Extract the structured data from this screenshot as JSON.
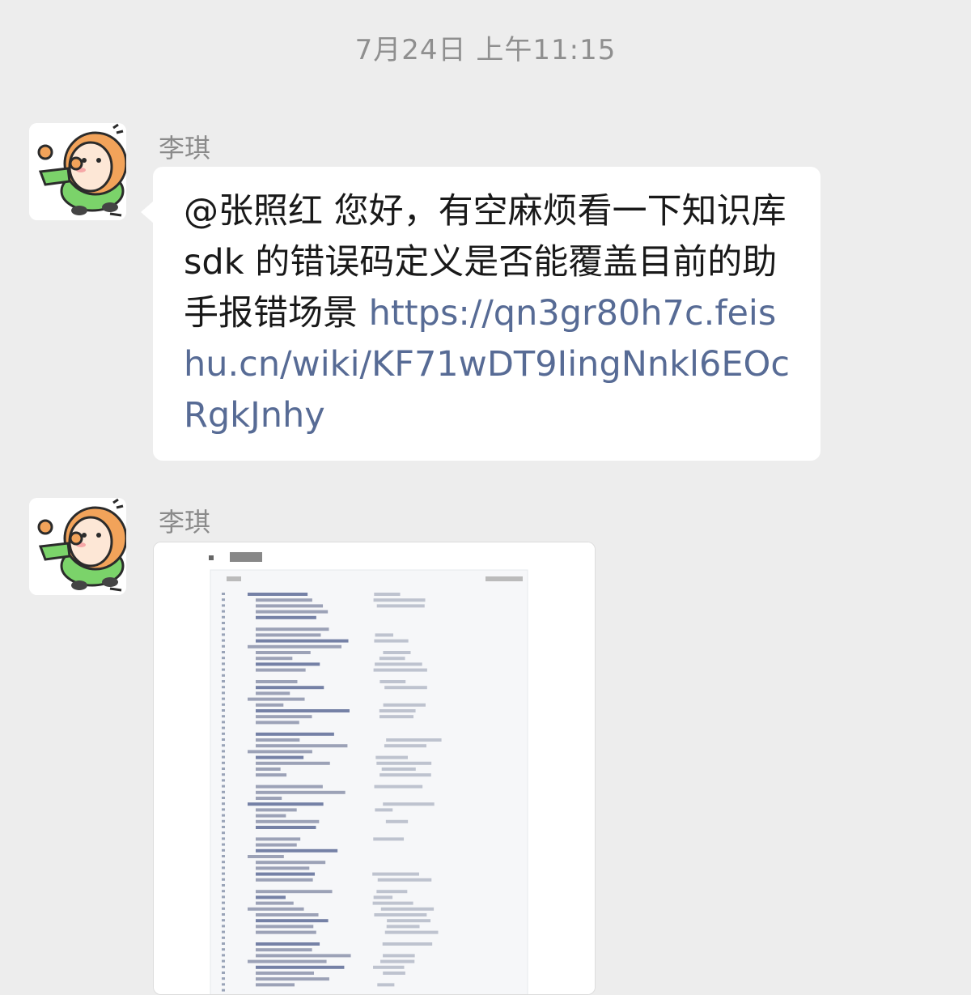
{
  "timestamp": "7月24日 上午11:15",
  "messages": [
    {
      "sender": "李琪",
      "text_parts": {
        "plain": "@张照红  您好，有空麻烦看一下知识库 sdk 的错误码定义是否能覆盖目前的助手报错场景 ",
        "link": "https://qn3gr80h7c.feishu.cn/wiki/KF71wDT9IingNnkl6EOcRgkJnhy"
      }
    },
    {
      "sender": "李琪",
      "image": "blurred-document-screenshot"
    }
  ],
  "colors": {
    "background": "#ededed",
    "bubble": "#ffffff",
    "link": "#576b95",
    "meta_text": "#8f8f8f"
  },
  "icons": {
    "avatar": "cartoon-character-avatar"
  }
}
